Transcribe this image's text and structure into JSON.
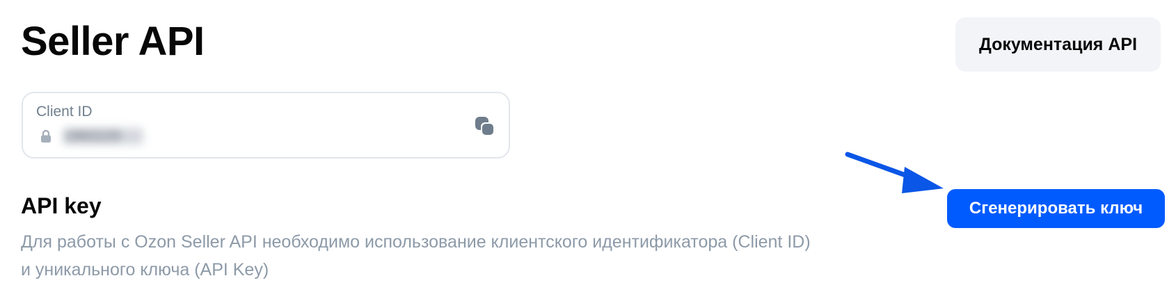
{
  "header": {
    "title": "Seller API",
    "docs_button_label": "Документация API"
  },
  "client_id": {
    "label": "Client ID",
    "value": "1960229",
    "lock_icon": "lock-icon",
    "copy_icon": "copy-icon"
  },
  "api_key": {
    "title": "API key",
    "description": "Для работы с Ozon Seller API необходимо использование клиентского идентификатора (Client ID) и уникального ключа (API Key)",
    "generate_button_label": "Сгенерировать ключ"
  },
  "colors": {
    "accent": "#005bff",
    "annotation_arrow": "#0a56e6",
    "muted_text": "#8d9aa8",
    "field_border": "#e2e6ec",
    "secondary_button_bg": "#f2f4f8"
  }
}
